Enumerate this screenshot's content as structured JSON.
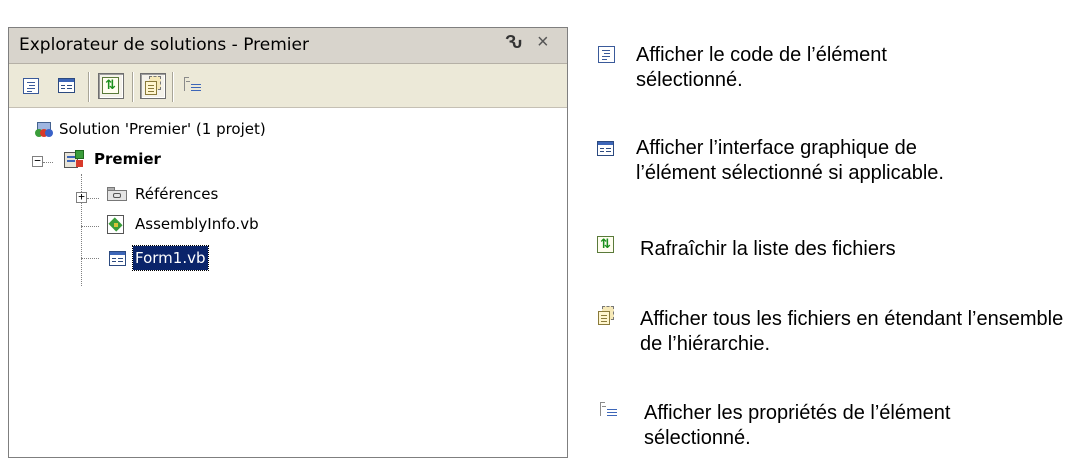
{
  "panel": {
    "title": "Explorateur de solutions - Premier",
    "pin_icon": "pin-icon",
    "pin_glyph": "Ԅ",
    "close_glyph": "×"
  },
  "toolbar": {
    "buttons": [
      {
        "icon": "view-code-icon"
      },
      {
        "icon": "view-designer-icon"
      },
      {
        "icon": "refresh-icon",
        "pressed": true
      },
      {
        "icon": "show-all-files-icon",
        "pressed": true
      },
      {
        "icon": "properties-icon"
      }
    ],
    "refresh_glyph": "⇅"
  },
  "tree": {
    "solution": "Solution 'Premier' (1 projet)",
    "project": "Premier",
    "items": [
      {
        "label": "Références",
        "icon": "references-folder-icon",
        "expander": "+"
      },
      {
        "label": "AssemblyInfo.vb",
        "icon": "vb-file-icon"
      },
      {
        "label": "Form1.vb",
        "icon": "form-file-icon",
        "selected": true
      }
    ],
    "project_expander": "−"
  },
  "legend": [
    {
      "icon": "view-code-icon",
      "text": "Afficher le code de l’élément sélectionné."
    },
    {
      "icon": "view-designer-icon",
      "text": "Afficher l’interface graphique de l’élément sélectionné si applicable."
    },
    {
      "icon": "refresh-icon",
      "text": "Rafraîchir la liste des fichiers"
    },
    {
      "icon": "show-all-files-icon",
      "text": "Afficher tous les fichiers en étendant l’ensemble de l’hiérarchie."
    },
    {
      "icon": "properties-icon",
      "text": "Afficher les propriétés de l’élément sélectionné."
    }
  ]
}
